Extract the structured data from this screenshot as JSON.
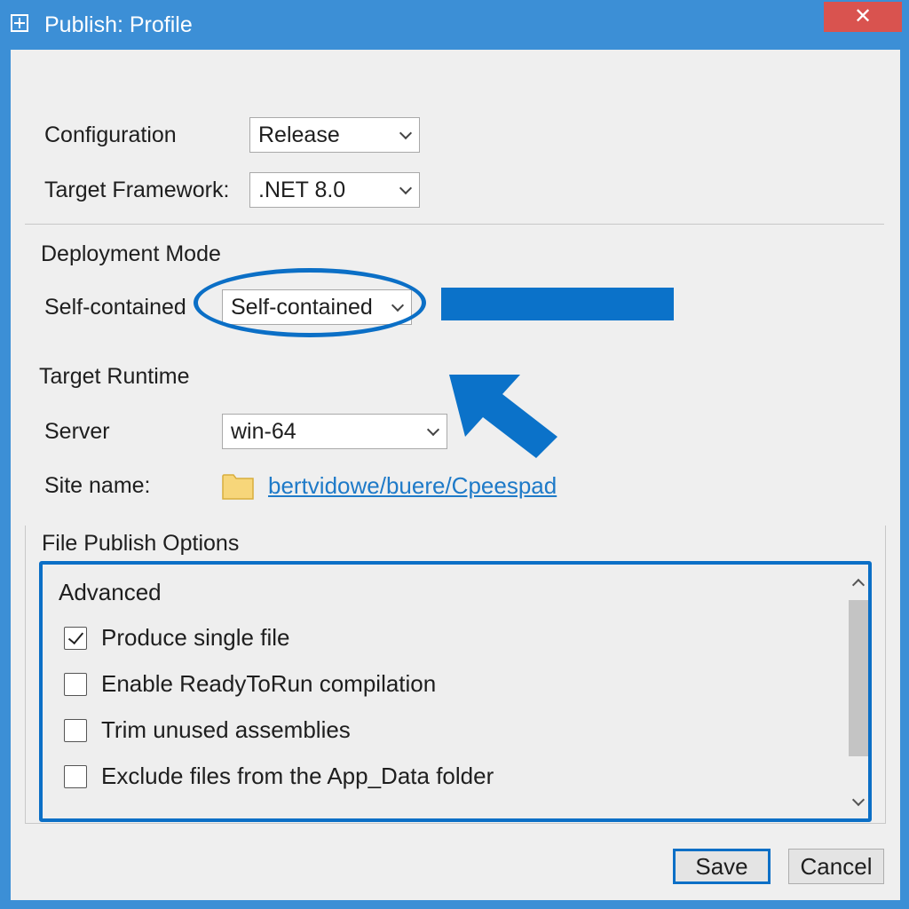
{
  "window": {
    "title": "Publish: Profile",
    "close_glyph": "✕"
  },
  "form": {
    "configuration": {
      "label": "Configuration",
      "value": "Release"
    },
    "target_framework": {
      "label": "Target Framework:",
      "value": ".NET 8.0"
    },
    "deployment_mode": {
      "heading": "Deployment Mode",
      "label": "Self-contained",
      "value": "Self-contained"
    },
    "target_runtime": {
      "heading": "Target Runtime",
      "server_label": "Server",
      "server_value": "win-64",
      "site_label": "Site name:",
      "site_value": "bertvidowe/buere/Cpeespad"
    }
  },
  "file_publish": {
    "heading": "File Publish Options",
    "advanced_title": "Advanced",
    "options": [
      {
        "label": "Produce single file",
        "checked": true
      },
      {
        "label": "Enable ReadyToRun compilation",
        "checked": false
      },
      {
        "label": "Trim unused assemblies",
        "checked": false
      },
      {
        "label": "Exclude files from the App_Data folder",
        "checked": false
      }
    ]
  },
  "buttons": {
    "save": "Save",
    "cancel": "Cancel"
  },
  "colors": {
    "accent": "#0b6fc6",
    "titlebar": "#3c8fd6",
    "close": "#d9534f",
    "link": "#1e7ac8",
    "folder": "#f7d67a"
  },
  "icons": [
    "app-icon",
    "close-icon",
    "chevron-down-icon",
    "folder-icon",
    "arrow-pointer-icon",
    "checkmark-icon",
    "scroll-up-icon",
    "scroll-down-icon"
  ]
}
